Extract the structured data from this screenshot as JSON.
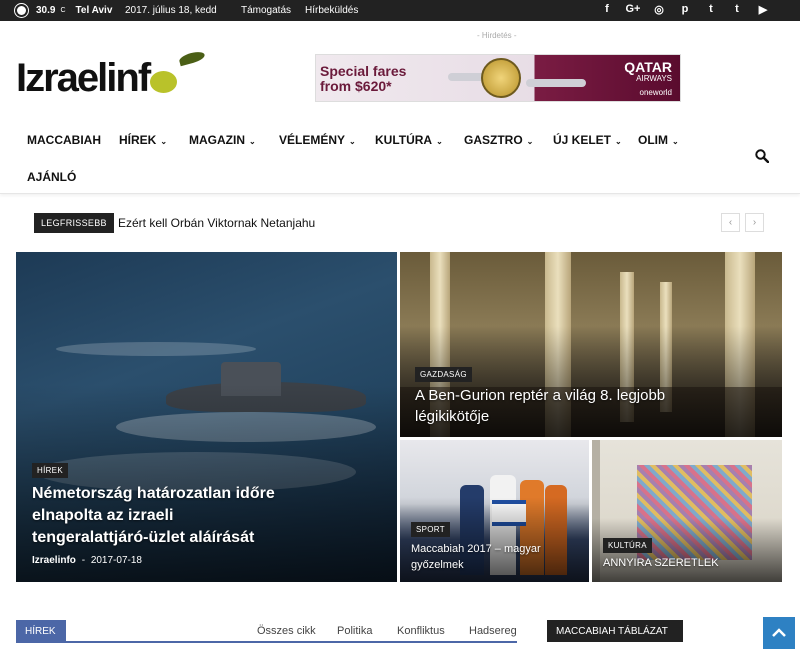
{
  "topbar": {
    "temperature": "30.9",
    "unit": "C",
    "city": "Tel Aviv",
    "date": "2017. július 18, kedd",
    "links": [
      "Támogatás",
      "Hírbeküldés"
    ],
    "social_icons": [
      "facebook-icon",
      "google-plus-icon",
      "instagram-icon",
      "pinterest-icon",
      "tumblr-icon",
      "twitter-icon",
      "youtube-icon"
    ],
    "social_glyphs": [
      "f",
      "G+",
      "◎",
      "p",
      "t",
      "t",
      "▶"
    ]
  },
  "header": {
    "logo_text": "Izraelinf",
    "ad_label": "- Hirdetés -",
    "banner": {
      "promo": "Special fares from $620*",
      "brand": "QATAR",
      "brand_sub": "AIRWAYS",
      "alliance": "oneworld"
    }
  },
  "nav": {
    "items": [
      {
        "label": "MACCABIAH",
        "dropdown": false
      },
      {
        "label": "HÍREK",
        "dropdown": true
      },
      {
        "label": "MAGAZIN",
        "dropdown": true
      },
      {
        "label": "VÉLEMÉNY",
        "dropdown": true
      },
      {
        "label": "KULTÚRA",
        "dropdown": true
      },
      {
        "label": "GASZTRO",
        "dropdown": true
      },
      {
        "label": "ÚJ KELET",
        "dropdown": true
      },
      {
        "label": "OLIM",
        "dropdown": true
      },
      {
        "label": "AJÁNLÓ",
        "dropdown": false
      }
    ]
  },
  "ticker": {
    "tag": "LEGFRISSEBB",
    "headline": "Ezért kell Orbán Viktornak Netanjahu",
    "prev": "‹",
    "next": "›"
  },
  "featured": [
    {
      "category": "HÍREK",
      "title": "Németország határozatlan időre elnapolta az izraeli tengeralattjáró-üzlet aláírását",
      "author": "Izraelinfo",
      "separator": "-",
      "date": "2017-07-18"
    },
    {
      "category": "GAZDASÁG",
      "title": "A Ben-Gurion reptér a világ 8. legjobb légikikötője"
    },
    {
      "category": "SPORT",
      "title": "Maccabiah 2017 – magyar győzelmek"
    },
    {
      "category": "KULTÚRA",
      "title": "ANNYIRA SZERETLEK"
    }
  ],
  "bottom": {
    "section_tab": "HÍREK",
    "filters": [
      "Összes cikk",
      "Politika",
      "Konfliktus",
      "Hadsereg"
    ],
    "sidebar_tab": "MACCABIAH TÁBLÁZAT"
  },
  "colors": {
    "topbar_bg": "#222222",
    "accent_blue": "#4c67a7",
    "scroll_top": "#2e81c3"
  }
}
